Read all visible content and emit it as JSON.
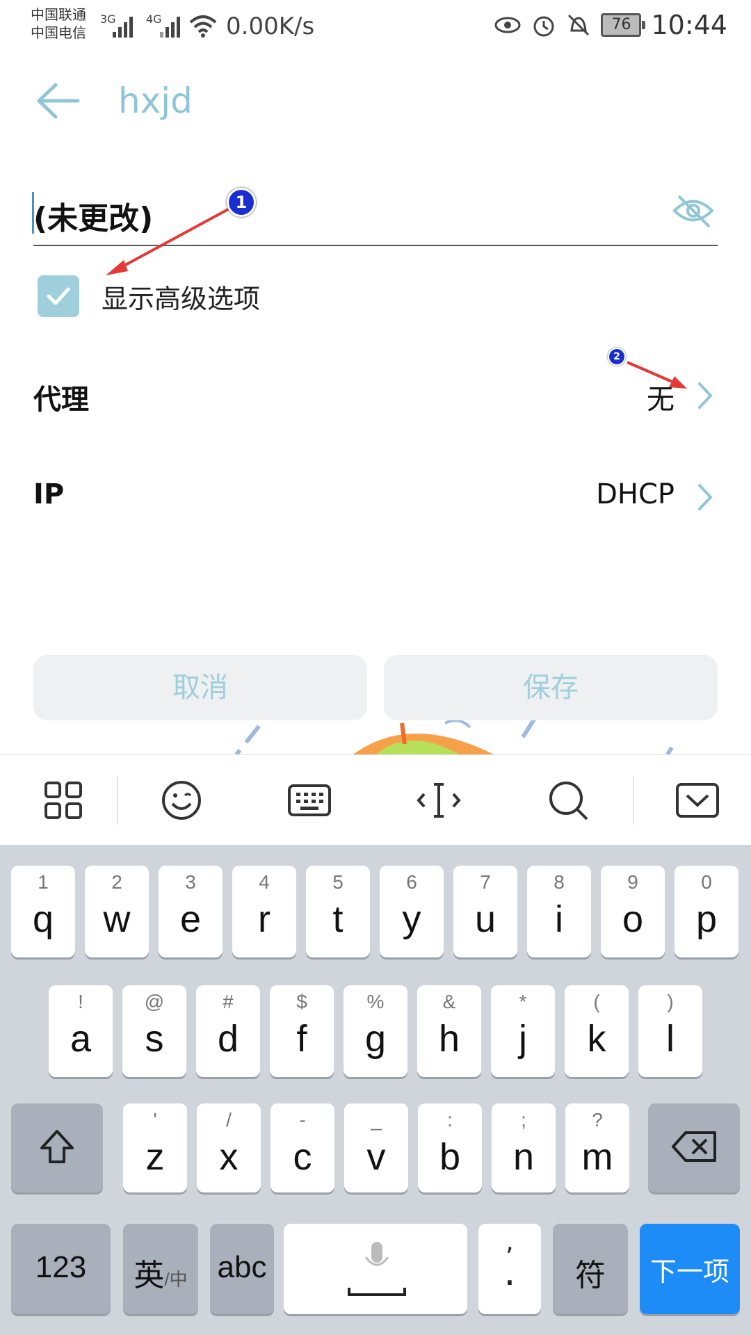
{
  "status_bar": {
    "carrier1": "中国联通",
    "carrier2": "中国电信",
    "net1": "3G",
    "net2": "4G",
    "speed": "0.00K/s",
    "battery": "76",
    "time": "10:44"
  },
  "header": {
    "title": "hxjd"
  },
  "password": {
    "value": "(未更改)"
  },
  "advanced": {
    "label": "显示高级选项",
    "checked": true
  },
  "rows": [
    {
      "label": "代理",
      "value": "无"
    },
    {
      "label": "IP",
      "value": "DHCP"
    }
  ],
  "buttons": {
    "cancel": "取消",
    "save": "保存"
  },
  "annotations": {
    "one": "1",
    "two": "2"
  },
  "keyboard": {
    "row1": [
      {
        "hint": "1",
        "ch": "q"
      },
      {
        "hint": "2",
        "ch": "w"
      },
      {
        "hint": "3",
        "ch": "e"
      },
      {
        "hint": "4",
        "ch": "r"
      },
      {
        "hint": "5",
        "ch": "t"
      },
      {
        "hint": "6",
        "ch": "y"
      },
      {
        "hint": "7",
        "ch": "u"
      },
      {
        "hint": "8",
        "ch": "i"
      },
      {
        "hint": "9",
        "ch": "o"
      },
      {
        "hint": "0",
        "ch": "p"
      }
    ],
    "row2": [
      {
        "hint": "!",
        "ch": "a"
      },
      {
        "hint": "@",
        "ch": "s"
      },
      {
        "hint": "#",
        "ch": "d"
      },
      {
        "hint": "$",
        "ch": "f"
      },
      {
        "hint": "%",
        "ch": "g"
      },
      {
        "hint": "&",
        "ch": "h"
      },
      {
        "hint": "*",
        "ch": "j"
      },
      {
        "hint": "(",
        "ch": "k"
      },
      {
        "hint": ")",
        "ch": "l"
      }
    ],
    "row3": [
      {
        "hint": "'",
        "ch": "z"
      },
      {
        "hint": "/",
        "ch": "x"
      },
      {
        "hint": "-",
        "ch": "c"
      },
      {
        "hint": "_",
        "ch": "v"
      },
      {
        "hint": ":",
        "ch": "b"
      },
      {
        "hint": ";",
        "ch": "n"
      },
      {
        "hint": "?",
        "ch": "m"
      }
    ],
    "num_key": "123",
    "lang_key": "英",
    "lang_key_sub": "/中",
    "abc_key": "abc",
    "comma_key": ",",
    "period_key": ".",
    "symbol_key": "符",
    "next_key": "下一项"
  }
}
